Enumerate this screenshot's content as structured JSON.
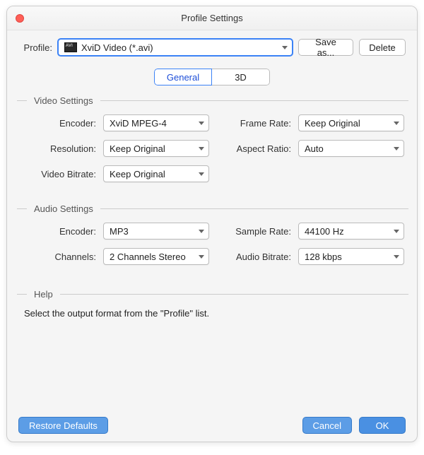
{
  "title": "Profile Settings",
  "profile": {
    "label": "Profile:",
    "value": "XviD Video (*.avi)",
    "save_as": "Save as...",
    "delete": "Delete"
  },
  "tabs": {
    "general": "General",
    "threeD": "3D"
  },
  "video": {
    "legend": "Video Settings",
    "encoder_label": "Encoder:",
    "encoder_value": "XviD MPEG-4",
    "resolution_label": "Resolution:",
    "resolution_value": "Keep Original",
    "video_bitrate_label": "Video Bitrate:",
    "video_bitrate_value": "Keep Original",
    "frame_rate_label": "Frame Rate:",
    "frame_rate_value": "Keep Original",
    "aspect_ratio_label": "Aspect Ratio:",
    "aspect_ratio_value": "Auto"
  },
  "audio": {
    "legend": "Audio Settings",
    "encoder_label": "Encoder:",
    "encoder_value": "MP3",
    "channels_label": "Channels:",
    "channels_value": "2 Channels Stereo",
    "sample_rate_label": "Sample Rate:",
    "sample_rate_value": "44100 Hz",
    "audio_bitrate_label": "Audio Bitrate:",
    "audio_bitrate_value": "128 kbps"
  },
  "help": {
    "legend": "Help",
    "text": "Select the output format from the \"Profile\" list."
  },
  "footer": {
    "restore": "Restore Defaults",
    "cancel": "Cancel",
    "ok": "OK"
  }
}
